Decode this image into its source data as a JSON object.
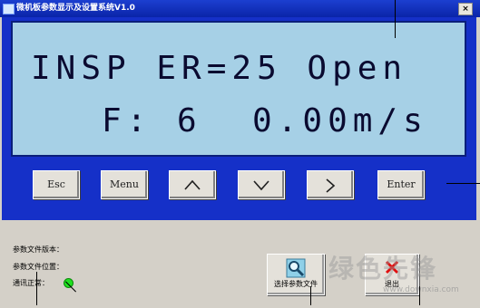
{
  "window": {
    "title": "微机板参数显示及设置系统V1.0",
    "close_label": "×"
  },
  "lcd": {
    "line1": "INSP ER=25 Open",
    "line2": "F: 6  0.00m/s"
  },
  "buttons": {
    "esc": "Esc",
    "menu": "Menu",
    "up_icon": "chevron-up-icon",
    "down_icon": "chevron-down-icon",
    "right_icon": "chevron-right-icon",
    "enter": "Enter"
  },
  "status": {
    "version_label": "参数文件版本：",
    "location_label": "参数文件位置：",
    "comm_label": "通讯正常：",
    "comm_led_color": "#20e020"
  },
  "toolbar": {
    "select_file_label": "选择参数文件",
    "exit_label": "退出"
  },
  "watermark": {
    "text": "绿色先锋",
    "url": "www.downxia.com"
  }
}
